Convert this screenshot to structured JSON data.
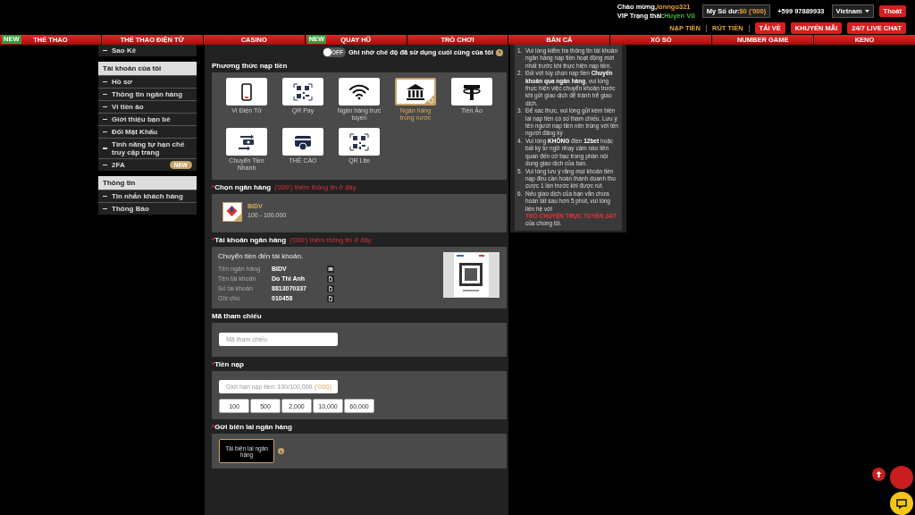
{
  "header": {
    "greeting": "Chào mừng,",
    "username": "lonngo321",
    "vip_label": "VIP Trạng thái:",
    "vip_value": "Huyền Vũ",
    "balance_label": "My Số dư:",
    "balance_value": "$0 ('000)",
    "phone": "+599 97889933",
    "language": "Vietnam",
    "logout": "Thoát",
    "links": [
      "NẠP TIỀN",
      "RÚT TIỀN"
    ],
    "buttons": [
      "TẢI VỀ",
      "KHUYẾN MÃI",
      "24/7 LIVE CHAT"
    ]
  },
  "nav": [
    {
      "label": "THỂ THAO",
      "badge": "NEW"
    },
    {
      "label": "THỂ THAO ĐIỆN TỬ"
    },
    {
      "label": "CASINO"
    },
    {
      "label": "QUAY HŨ",
      "badge": "NEW"
    },
    {
      "label": "TRÒ CHƠI"
    },
    {
      "label": "BẮN CÁ"
    },
    {
      "label": "XỔ SỐ"
    },
    {
      "label": "NUMBER GAME"
    },
    {
      "label": "KENO"
    }
  ],
  "sidebar": [
    {
      "items": [
        {
          "label": "Sao Kê",
          "selected": false
        }
      ]
    },
    {
      "title": "Tài khoản của tôi",
      "items": [
        {
          "label": "Hồ sơ",
          "selected": false
        },
        {
          "label": "Thông tin ngân hàng",
          "selected": false
        },
        {
          "label": "Ví tiền ảo",
          "selected": false
        },
        {
          "label": "Giới thiệu bạn bè",
          "selected": false
        },
        {
          "label": "Đổi Mật Khẩu",
          "selected": false
        },
        {
          "label": "Tính năng tự hạn chế truy cập trang",
          "selected": false
        },
        {
          "label": "2FA",
          "badge": "NEW",
          "selected": false
        }
      ]
    },
    {
      "title": "Thông tin",
      "items": [
        {
          "label": "Tin nhắn khách hàng",
          "selected": false
        },
        {
          "label": "Thông Báo",
          "selected": false
        }
      ]
    }
  ],
  "remember": {
    "on": false,
    "state_label": "OFF",
    "label": "Ghi nhớ chế độ đã sử dụng cuối cùng của tôi"
  },
  "methods": {
    "title": "Phương thức nạp tiền",
    "items": [
      {
        "label": "Ví Điện Tử",
        "kind": "phone",
        "selected": false
      },
      {
        "label": "QR Pay",
        "kind": "qr",
        "selected": false
      },
      {
        "label": "Ngân hàng trực tuyến",
        "kind": "wifi",
        "selected": false
      },
      {
        "label": "Ngân hàng trong nước",
        "kind": "bank",
        "selected": true
      },
      {
        "label": "Tiền Ảo",
        "kind": "tether",
        "selected": false
      },
      {
        "label": "Chuyển Tiền Nhanh",
        "kind": "transfer",
        "selected": false
      },
      {
        "label": "THẺ CÀO",
        "kind": "card",
        "selected": false
      },
      {
        "label": "QR Lite",
        "kind": "qr",
        "selected": false
      }
    ]
  },
  "bank": {
    "required_mark": "*",
    "title": "Chọn ngân hàng",
    "note": "('000') thêm thông tin ở đây",
    "items": [
      {
        "name": "BIDV",
        "range": "100 - 100,000",
        "selected": true
      }
    ]
  },
  "account": {
    "required_mark": "*",
    "title": "Tài khoản ngân hàng",
    "note": "('000') thêm thông tin ở đây",
    "intro": "Chuyển tiền đến tài khoản.",
    "rows": [
      {
        "label": "Tên ngân hàng",
        "value": "BIDV",
        "kind": "image"
      },
      {
        "label": "Tên tài khoản",
        "value": "Do Thi Anh",
        "kind": "copy"
      },
      {
        "label": "Số tài khoản",
        "value": "8813070337",
        "kind": "copy"
      },
      {
        "label": "Ghi chú",
        "value": "010458",
        "kind": "copy"
      }
    ]
  },
  "reference": {
    "title": "Mã tham chiếu",
    "placeholder": "Mã tham chiếu"
  },
  "amount": {
    "required_mark": "*",
    "title": "Tiền nạp",
    "placeholder": "Giới hạn nạp tiền: 100/100,000",
    "unit": "('000)",
    "quick": [
      "100",
      "500",
      "2,000",
      "10,000",
      "60,000"
    ]
  },
  "receipt": {
    "required_mark": "*",
    "title": "Gửi biên lai ngân hàng",
    "button": "Tải biên lai ngân hàng"
  },
  "notes": [
    {
      "marker": "1.",
      "text": "Vui lòng kiểm tra thông tin tài khoản ngân hàng nạp tiền hoạt động mới nhất trước khi thực hiện nạp tiền."
    },
    {
      "marker": "2.",
      "text": "Đối với tùy chọn nạp tiền **Chuyển khoản qua ngân hàng**, vui lòng thực hiện việc chuyển khoản trước khi gửi giao dịch để tránh trễ giao dịch."
    },
    {
      "marker": "3.",
      "text": "Để xác thực, vui lòng gửi kèm biên lai nạp tiền có số tham chiếu. Lưu ý tên người nạp tiền nên trùng với tên người đăng ký"
    },
    {
      "marker": "4.",
      "text": "Vui lòng **KHÔNG** điền **12bet** hoặc bất kỳ từ ngữ nhạy cảm nào liên quan đến cờ bạc trong phần nội dung giao dịch của bạn."
    },
    {
      "marker": "5.",
      "text": "Vui lòng lưu ý rằng mọi khoản tiền nạp đều cần hoàn thành doanh thu cược 1 lần trước khi được rút."
    },
    {
      "marker": "6.",
      "text": "Nếu giao dịch của bạn vẫn chưa hoàn tất sau hơn 5 phút, vui lòng liên hệ với",
      "link": "TRÒ CHUYỆN TRỰC TUYẾN 24/7",
      "after": "của chúng tôi."
    }
  ]
}
